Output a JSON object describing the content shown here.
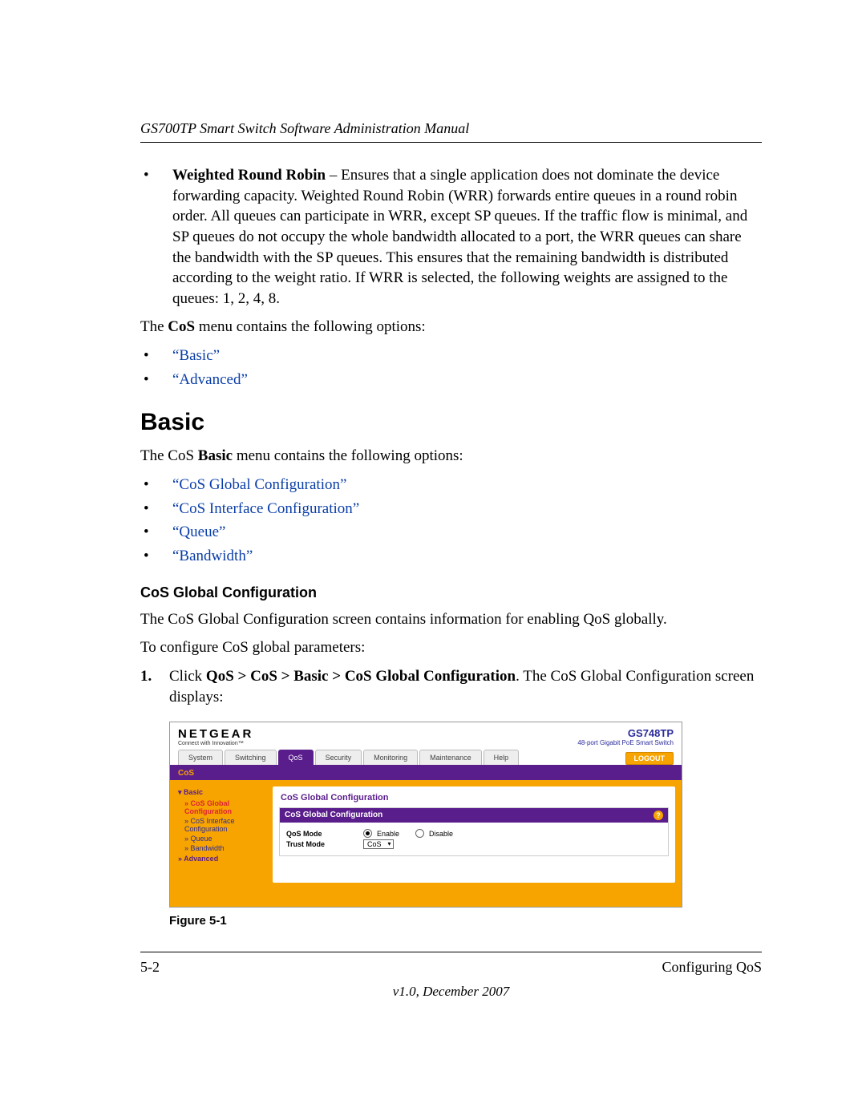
{
  "header": {
    "running": "GS700TP Smart Switch Software Administration Manual"
  },
  "content": {
    "wrr_term": "Weighted Round Robin",
    "wrr_text": " – Ensures that a single application does not dominate the device forwarding capacity. Weighted Round Robin (WRR) forwards entire queues in a round robin order. All queues can participate in WRR, except SP queues. If the traffic flow is minimal, and SP queues do not occupy the whole bandwidth allocated to a port, the WRR queues can share the bandwidth with the SP queues. This ensures that the remaining bandwidth is distributed according to the weight ratio. If WRR is selected, the following weights are assigned to the queues: 1, 2, 4, 8.",
    "cos_menu_intro_pre": "The ",
    "cos_menu_intro_bold": "CoS",
    "cos_menu_intro_post": " menu contains the following options:",
    "cos_options": [
      "“Basic”",
      "“Advanced”"
    ],
    "h2_basic": "Basic",
    "basic_intro_pre": "The CoS ",
    "basic_intro_bold": "Basic",
    "basic_intro_post": " menu contains the following options:",
    "basic_options": [
      "“CoS Global Configuration”",
      "“CoS Interface Configuration”",
      "“Queue”",
      "“Bandwidth”"
    ],
    "h3_cos_global": "CoS Global Configuration",
    "cos_global_desc": "The CoS Global Configuration screen contains information for enabling QoS globally.",
    "cos_global_steps_intro": "To configure CoS global parameters:",
    "step1_num": "1.",
    "step1_pre": "Click ",
    "step1_bold": "QoS > CoS > Basic > CoS Global Configuration",
    "step1_post": ". The CoS Global Configuration screen displays:",
    "figure_caption": "Figure 5-1"
  },
  "screenshot": {
    "logo": "NETGEAR",
    "logo_tag": "Connect with Innovation™",
    "model_num": "GS748TP",
    "model_tag": "48-port Gigabit PoE Smart Switch",
    "tabs": [
      "System",
      "Switching",
      "QoS",
      "Security",
      "Monitoring",
      "Maintenance",
      "Help"
    ],
    "active_tab_index": 2,
    "logout": "LOGOUT",
    "subtab": "CoS",
    "sidebar": {
      "group_basic": "▾ Basic",
      "items": [
        "» CoS Global Configuration",
        "» CoS Interface Configuration",
        "» Queue",
        "» Bandwidth"
      ],
      "group_advanced": "» Advanced"
    },
    "panel_title": "CoS Global Configuration",
    "panel_head": "CoS Global Configuration",
    "help_icon": "?",
    "form": {
      "qos_mode_label": "QoS Mode",
      "enable_label": "Enable",
      "disable_label": "Disable",
      "trust_mode_label": "Trust Mode",
      "trust_mode_value": "CoS"
    }
  },
  "footer": {
    "page_num": "5-2",
    "section": "Configuring QoS",
    "version": "v1.0, December 2007"
  }
}
